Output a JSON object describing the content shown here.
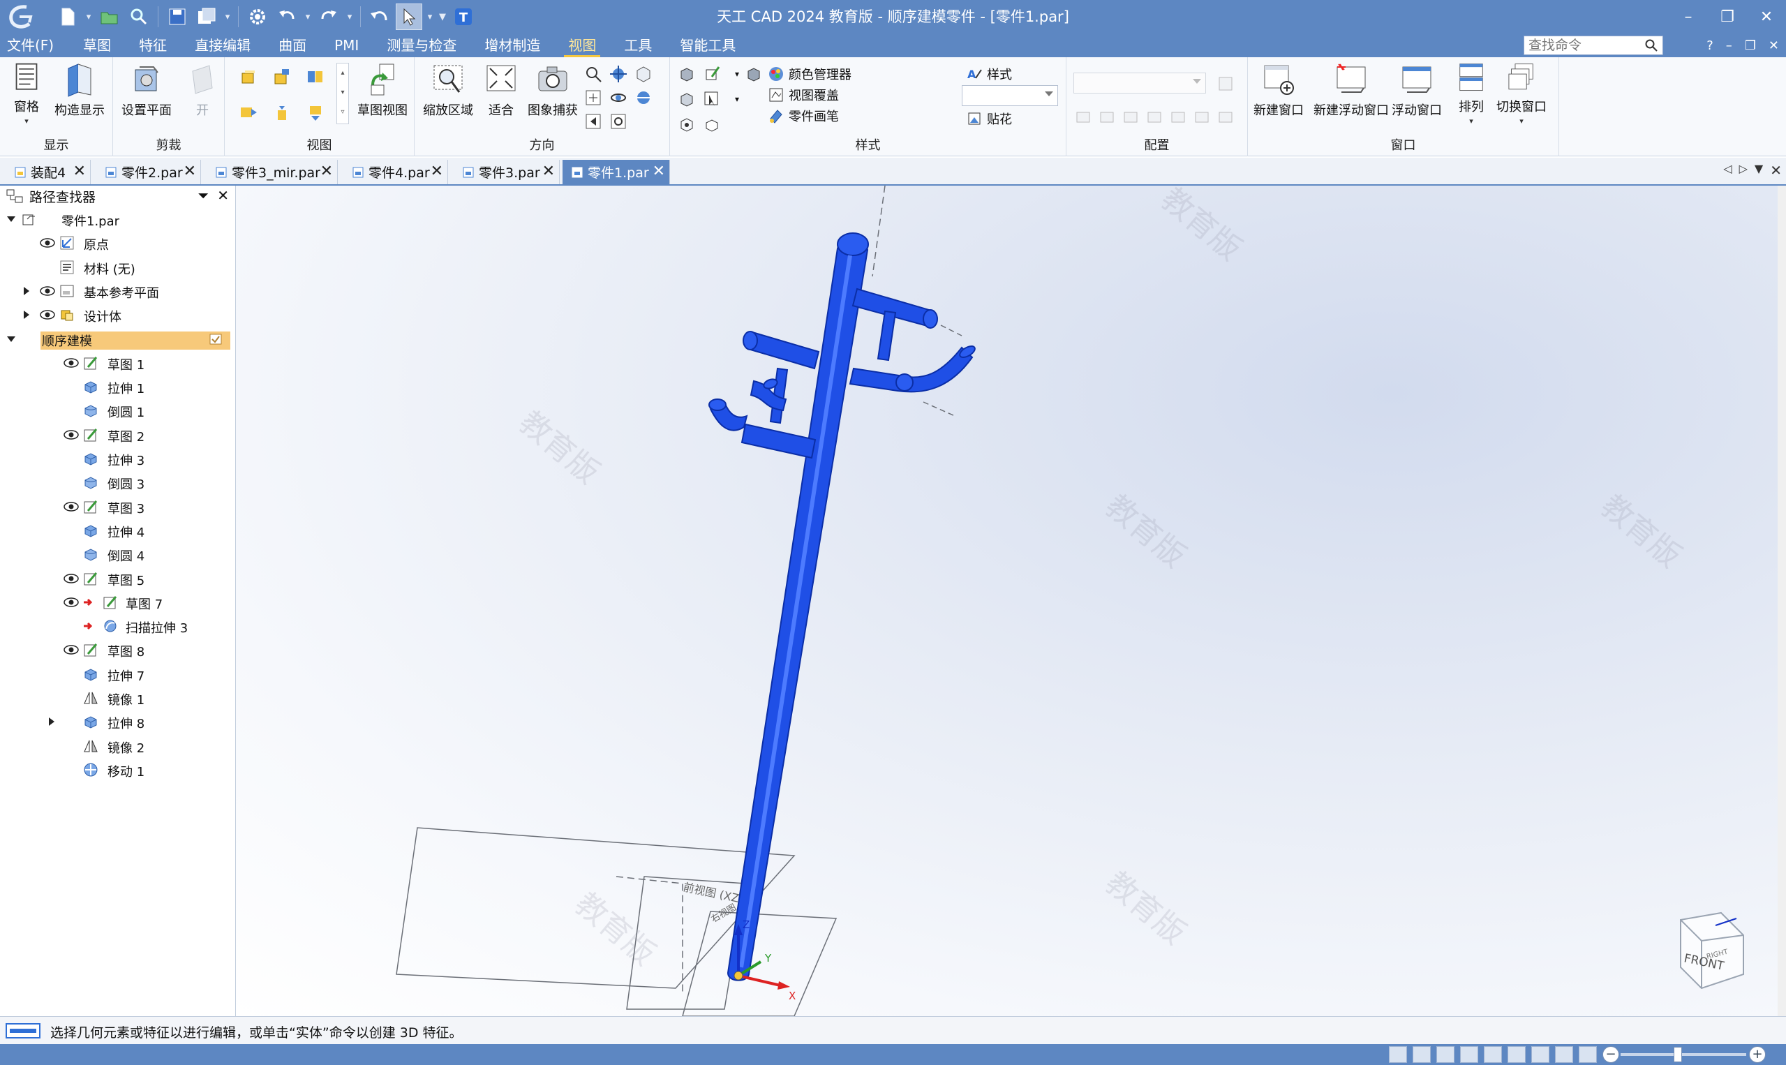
{
  "title_bar": {
    "window_title": "天工 CAD 2024 教育版 - 顺序建模零件 - [零件1.par]"
  },
  "menu": {
    "items": [
      "文件(F)",
      "草图",
      "特征",
      "直接编辑",
      "曲面",
      "PMI",
      "测量与检查",
      "增材制造",
      "视图",
      "工具",
      "智能工具"
    ],
    "active": "视图",
    "search_placeholder": "查找命令",
    "help": "?"
  },
  "ribbon": {
    "groups": {
      "display": {
        "label": "显示",
        "buttons": [
          "窗格",
          "构造显示"
        ]
      },
      "clip": {
        "label": "剪裁",
        "buttons": [
          "设置平面",
          "开"
        ]
      },
      "views": {
        "label": "视图",
        "buttons": [
          "草图视图"
        ]
      },
      "orient": {
        "label": "方向",
        "buttons": [
          "缩放区域",
          "适合",
          "图象捕获"
        ]
      },
      "style": {
        "label": "样式",
        "buttons": [
          "颜色管理器",
          "视图覆盖",
          "零件画笔",
          "样式",
          "贴花"
        ]
      },
      "config": {
        "label": "配置"
      },
      "window": {
        "label": "窗口",
        "buttons": [
          "新建窗口",
          "新建浮动窗口",
          "浮动窗口",
          "排列",
          "切换窗口"
        ]
      }
    }
  },
  "doc_tabs": [
    {
      "label": "装配4",
      "active": false
    },
    {
      "label": "零件2.par",
      "active": false
    },
    {
      "label": "零件3_mir.par",
      "active": false
    },
    {
      "label": "零件4.par",
      "active": false
    },
    {
      "label": "零件3.par",
      "active": false
    },
    {
      "label": "零件1.par",
      "active": true
    }
  ],
  "pathfinder": {
    "title": "路径查找器",
    "tree": [
      {
        "label": "零件1.par"
      },
      {
        "label": "原点"
      },
      {
        "label": "材料 (无)"
      },
      {
        "label": "基本参考平面"
      },
      {
        "label": "设计体"
      },
      {
        "label": "顺序建模"
      },
      {
        "label": "草图 1"
      },
      {
        "label": "拉伸 1"
      },
      {
        "label": "倒圆 1"
      },
      {
        "label": "草图 2"
      },
      {
        "label": "拉伸 3"
      },
      {
        "label": "倒圆 3"
      },
      {
        "label": "草图 3"
      },
      {
        "label": "拉伸 4"
      },
      {
        "label": "倒圆 4"
      },
      {
        "label": "草图 5"
      },
      {
        "label": "草图 7"
      },
      {
        "label": "扫描拉伸 3"
      },
      {
        "label": "草图 8"
      },
      {
        "label": "拉伸 7"
      },
      {
        "label": "镜像 1"
      },
      {
        "label": "拉伸 8"
      },
      {
        "label": "镜像 2"
      },
      {
        "label": "移动 1"
      }
    ]
  },
  "viewport": {
    "watermark": "教育版",
    "plane_label": "前视图 (XZ)",
    "plane_label_2": "右视图",
    "axis_x": "X",
    "axis_y": "Y",
    "axis_z": "Z",
    "view_cube_face": "FRONT",
    "view_cube_side": "RIGHT",
    "model_color": "#1f4fe6"
  },
  "status": {
    "message": "选择几何元素或特征以进行编辑，或单击“实体”命令以创建 3D 特征。"
  },
  "colors": {
    "title_bg": "#5d87c2",
    "active_tab": "#5d87c2",
    "selected_tree": "#f7c97a",
    "menu_active": "#ffe79a"
  }
}
